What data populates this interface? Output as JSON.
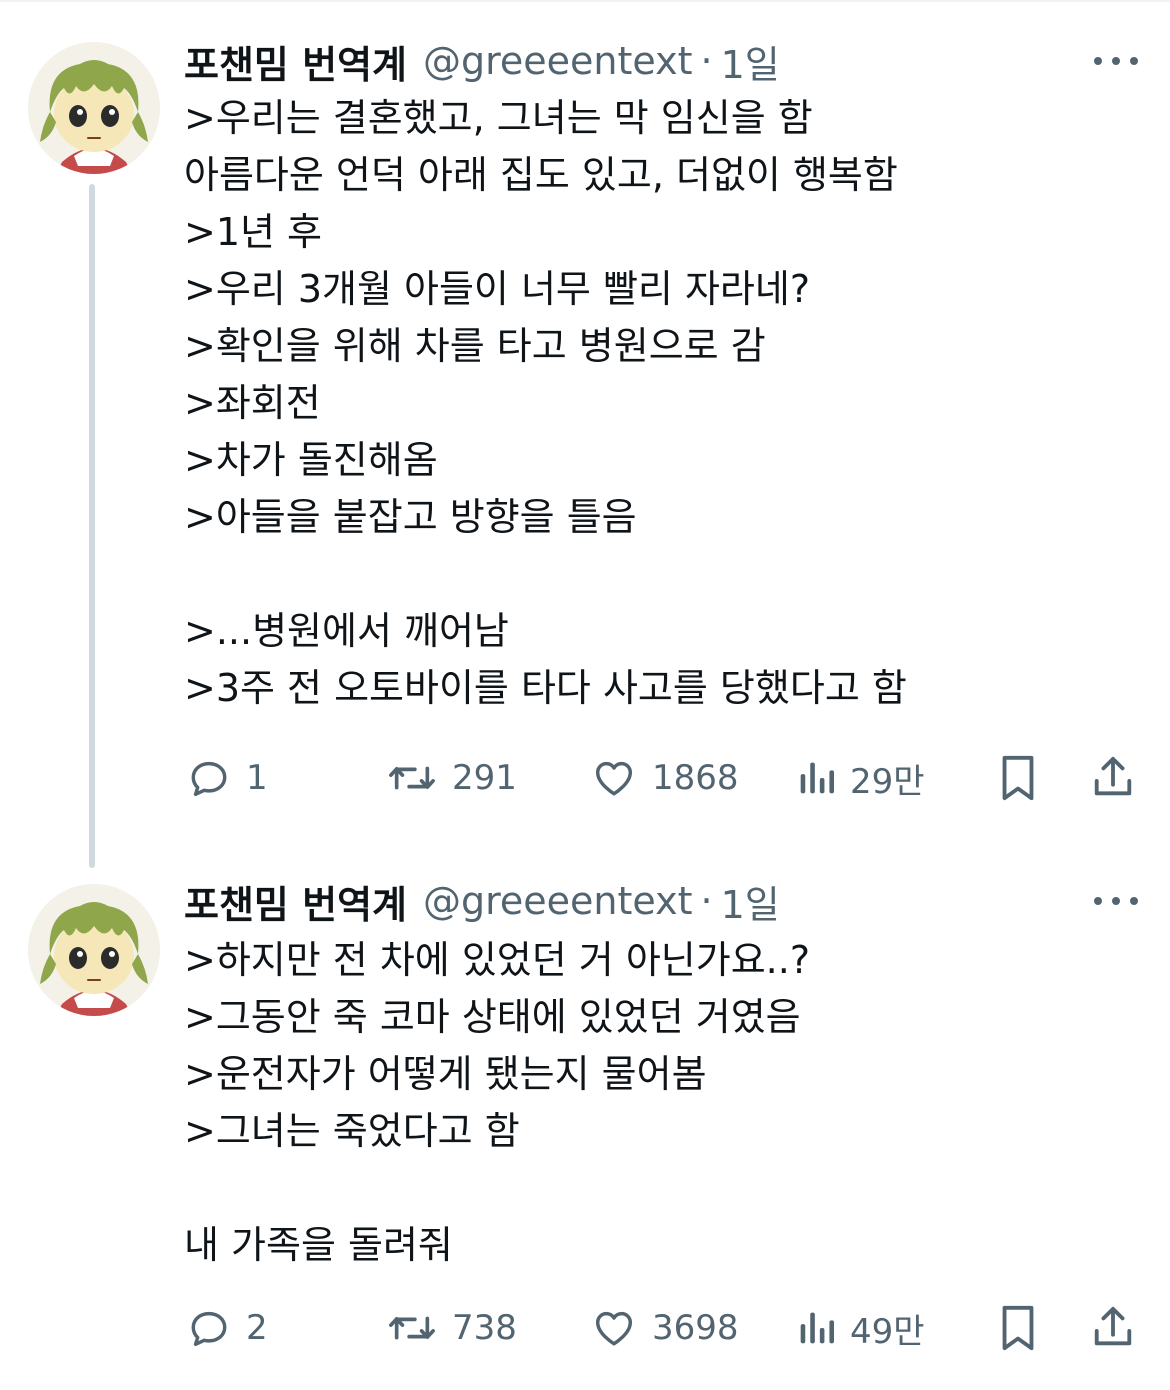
{
  "tweets": [
    {
      "author": {
        "display_name": "포챈밈 번역계",
        "handle": "@greeeentext",
        "time": "1일",
        "separator": "·"
      },
      "lines": [
        ">우리는 결혼했고, 그녀는 막 임신을 함",
        "아름다운 언덕 아래 집도 있고, 더없이 행복함",
        ">1년 후",
        ">우리 3개월 아들이 너무 빨리 자라네?",
        ">확인을 위해 차를 타고 병원으로 감",
        ">좌회전",
        ">차가 돌진해옴",
        ">아들을 붙잡고 방향을 틀음",
        "",
        ">...병원에서 깨어남",
        ">3주 전 오토바이를 타다 사고를 당했다고 함"
      ],
      "stats": {
        "replies": "1",
        "retweets": "291",
        "likes": "1868",
        "views": "29만"
      }
    },
    {
      "author": {
        "display_name": "포챈밈 번역계",
        "handle": "@greeeentext",
        "time": "1일",
        "separator": "·"
      },
      "lines": [
        ">하지만 전 차에 있었던 거 아닌가요..?",
        ">그동안 죽 코마 상태에 있었던 거였음",
        ">운전자가 어떻게 됐는지 물어봄",
        ">그녀는 죽었다고 함",
        "",
        "내 가족을 돌려줘"
      ],
      "stats": {
        "replies": "2",
        "retweets": "738",
        "likes": "3698",
        "views": "49만"
      }
    }
  ],
  "icons": {
    "reply": "reply-icon",
    "retweet": "retweet-icon",
    "like": "heart-icon",
    "views": "views-icon",
    "bookmark": "bookmark-icon",
    "share": "share-icon",
    "more": "more-icon"
  },
  "colors": {
    "text": "#0f1419",
    "secondary": "#536471",
    "thread_line": "#cfd9de"
  }
}
